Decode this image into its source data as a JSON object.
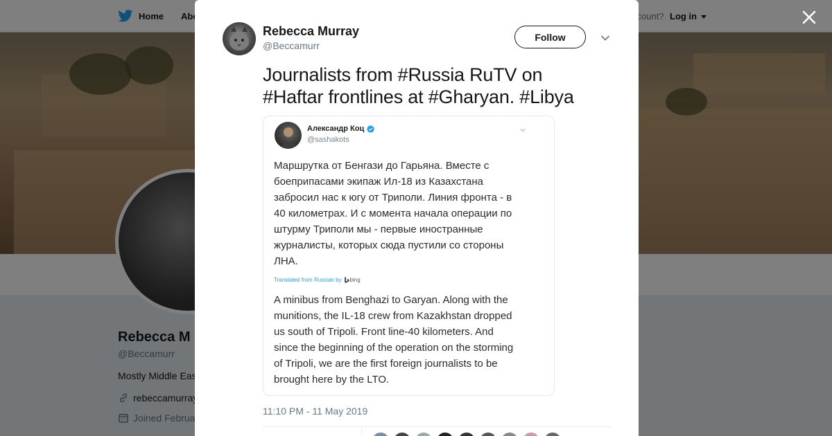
{
  "nav": {
    "home_label": "Home",
    "about_label": "Abo",
    "account_prompt": "ccount?",
    "login_label": "Log in"
  },
  "profile": {
    "name": "Rebecca M",
    "handle": "@Beccamurr",
    "bio": "Mostly Middle Eas",
    "link": "rebeccamurray",
    "joined": "Joined Februa"
  },
  "tweet": {
    "author_name": "Rebecca Murray",
    "author_handle": "@Beccamurr",
    "follow_label": "Follow",
    "text_line1": "Journalists from #Russia RuTV on",
    "text_line2": "#Haftar frontlines at #Gharyan. #Libya",
    "timestamp": "11:10 PM - 11 May 2019"
  },
  "embedded_screenshot": {
    "author_name": "Александр Коц",
    "author_handle": "@sashakots",
    "text": "Маршрутка от Бенгази до Гарьяна. Вместе с\nбоеприпасами экипаж Ил-18 из Казахстана\nзабросил нас к югу от Триполи. Линия фронта - в\n40 километрах. И с момента начала операции по\nштурму Триполи мы - первые иностранные\nжурналисты, которых сюда пустили со стороны\nЛНА.",
    "translated_label": "Translated from Russian by",
    "bing_label": "bing",
    "translation": "A minibus from Benghazi to Garyan. Along with the\nmunitions, the IL-18 crew from Kazakhstan dropped\nus south of Tripoli. Front line-40 kilometers. And\nsince the beginning of the operation on the storming\nof Tripoli, we are the first foreign journalists to be\nbrought here by the LTO."
  },
  "colors": {
    "twitter_blue": "#1da1f2",
    "text_dark": "#14171a",
    "text_muted": "#657786"
  }
}
